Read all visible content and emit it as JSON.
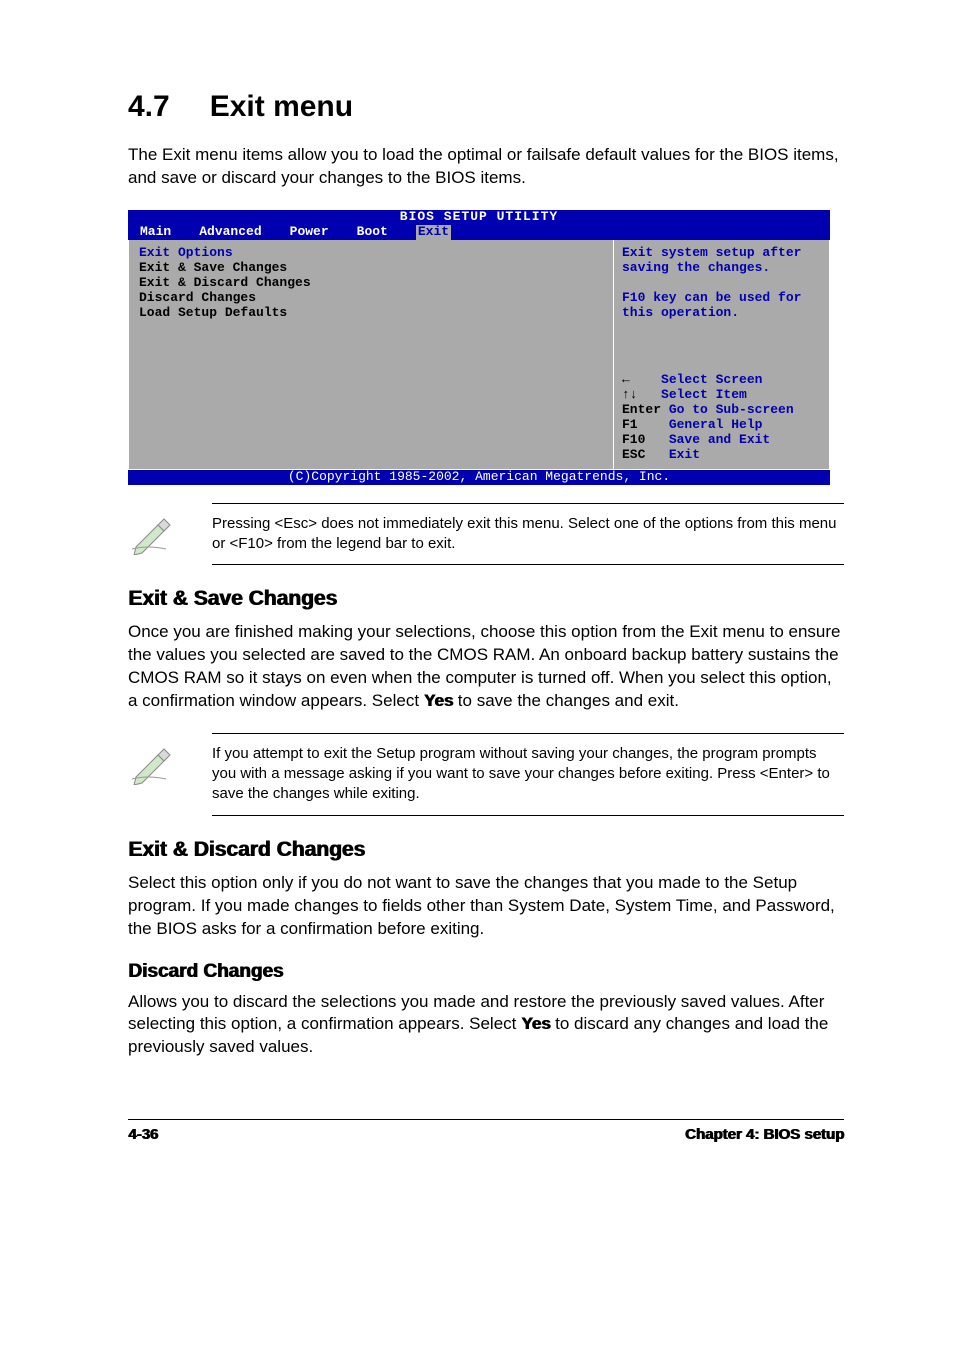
{
  "heading": {
    "number": "4.7",
    "title": "Exit menu"
  },
  "intro": "The Exit menu items allow you to load the optimal or failsafe default values for the BIOS items, and save or discard your changes to the BIOS items.",
  "bios": {
    "title": "BIOS SETUP UTILITY",
    "tabs": [
      "Main",
      "Advanced",
      "Power",
      "Boot",
      "Exit"
    ],
    "active_tab": "Exit",
    "section_label": "Exit Options",
    "items": [
      "Exit & Save Changes",
      "Exit & Discard Changes",
      "Discard Changes",
      "",
      "Load Setup Defaults"
    ],
    "help_top": "Exit system setup after saving the changes.\n\nF10 key can be used for this operation.",
    "help_bottom": [
      {
        "key": "←",
        "action": "Select Screen"
      },
      {
        "key": "↑↓",
        "action": "Select Item"
      },
      {
        "key": "Enter",
        "action": "Go to Sub-screen"
      },
      {
        "key": "F1",
        "action": "General Help"
      },
      {
        "key": "F10",
        "action": "Save and Exit"
      },
      {
        "key": "ESC",
        "action": "Exit"
      }
    ],
    "footer": "(C)Copyright 1985-2002, American Megatrends, Inc."
  },
  "note1": "Pressing <Esc> does not immediately exit this menu. Select one of the options from this menu or <F10> from the legend bar to exit.",
  "sections": {
    "exit_save": {
      "title": "Exit & Save Changes",
      "body_a": "Once you are finished making your selections, choose this option from the Exit menu to ensure the values you selected are saved to the CMOS RAM. An onboard backup battery sustains the CMOS RAM so it stays on even when the computer is turned off. When you select this option, a confirmation window appears. Select ",
      "yes": "Yes",
      "body_b": " to save the changes and exit."
    },
    "note2": " If you attempt to exit the Setup program without saving your changes, the program prompts you with a message asking if you want to save your changes before exiting. Press <Enter>  to save the  changes while exiting.",
    "exit_discard": {
      "title": "Exit & Discard Changes",
      "body": "Select this option only if you do not want to save the changes that you made to the Setup program. If you made changes to fields other than System Date, System Time, and Password, the BIOS asks for a confirmation before exiting."
    },
    "discard": {
      "title": "Discard Changes",
      "body_a": "Allows you to discard the selections you made and restore the previously saved values. After selecting this option, a confirmation appears. Select ",
      "yes": "Yes",
      "body_b": " to discard any changes and load the previously saved values."
    }
  },
  "footer": {
    "left": "4-36",
    "right": "Chapter 4: BIOS setup"
  }
}
